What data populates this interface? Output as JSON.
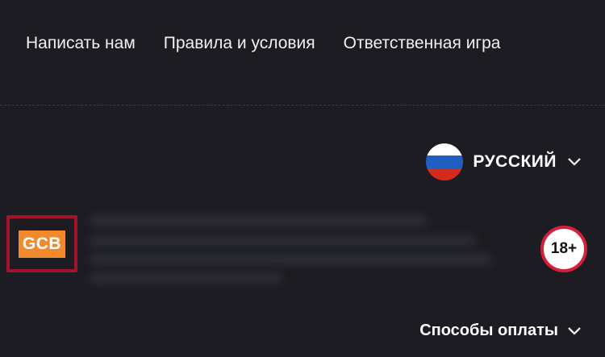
{
  "footer": {
    "links": [
      "Написать нам",
      "Правила и условия",
      "Ответственная игра"
    ]
  },
  "language": {
    "label": "РУССКИЙ",
    "flag_colors": [
      "#ffffff",
      "#1f5fbf",
      "#d52b1e"
    ]
  },
  "license": {
    "logo_text": "GCB"
  },
  "age_badge": "18+",
  "payment_methods": {
    "label": "Способы оплаты"
  },
  "colors": {
    "background": "#1c1c22",
    "accent_red": "#a3132a",
    "gcb_orange": "#f08a2c"
  }
}
